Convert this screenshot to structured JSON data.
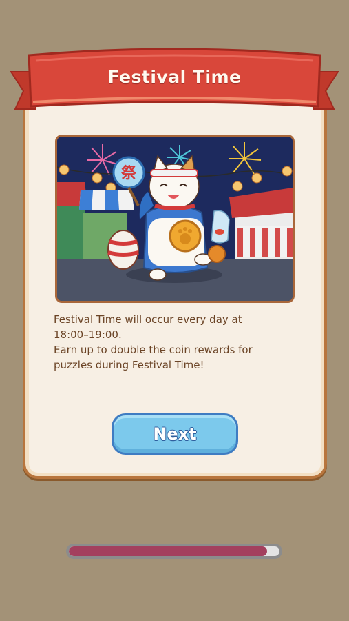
{
  "dialog": {
    "title": "Festival Time",
    "scene_sign": "祭",
    "description_lines": [
      "Festival Time will occur every day at",
      "18:00–19:00.",
      "Earn up to double the coin rewards for",
      "puzzles during Festival Time!"
    ],
    "next_label": "Next"
  },
  "loading": {
    "progress": 0.94
  },
  "colors": {
    "background": "#a39277",
    "ribbon": "#d9473a",
    "card": "#f7efe4",
    "button": "#7cc9ec",
    "progress_fill": "#a3405e"
  }
}
